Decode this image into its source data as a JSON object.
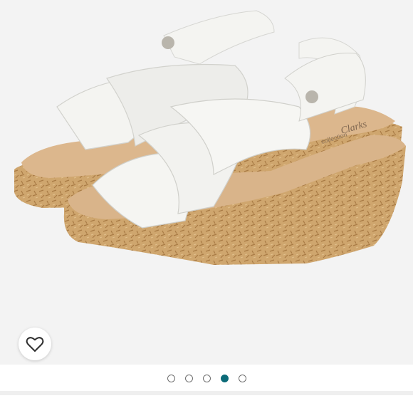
{
  "product": {
    "brand_logo_text": "Clarks",
    "brand_sub_text": "collection",
    "colors": {
      "leather": "#f4f4f1",
      "cork": "#c9a068",
      "footbed": "#d9b48a"
    }
  },
  "like_button": {
    "icon": "heart-outline-icon"
  },
  "pager": {
    "count": 5,
    "active_index": 3,
    "active_color": "#0c6b78"
  },
  "below_fold": {
    "text": ""
  }
}
